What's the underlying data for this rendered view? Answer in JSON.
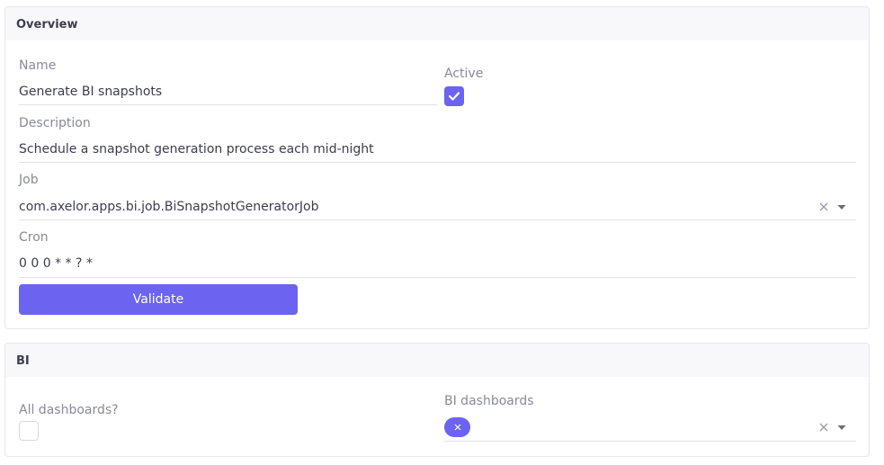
{
  "overview": {
    "title": "Overview",
    "name_label": "Name",
    "name_value": "Generate BI snapshots",
    "active_label": "Active",
    "active_checked": true,
    "description_label": "Description",
    "description_value": "Schedule a snapshot generation process each mid-night",
    "job_label": "Job",
    "job_value": "com.axelor.apps.bi.job.BiSnapshotGeneratorJob",
    "cron_label": "Cron",
    "cron_value": "0 0 0 * * ? *",
    "validate_label": "Validate"
  },
  "bi": {
    "title": "BI",
    "all_dashboards_label": "All dashboards?",
    "all_dashboards_checked": false,
    "bi_dashboards_label": "BI dashboards"
  },
  "icons": {
    "check": "check-icon",
    "clear": "clear-icon",
    "dropdown": "chevron-down-icon",
    "tag_remove": "tag-remove-icon"
  },
  "colors": {
    "accent": "#6c63f0",
    "panel_header_bg": "#f8f8fb",
    "border": "#e6e6ec",
    "label": "#8a8a99",
    "text": "#3d3d4e"
  }
}
